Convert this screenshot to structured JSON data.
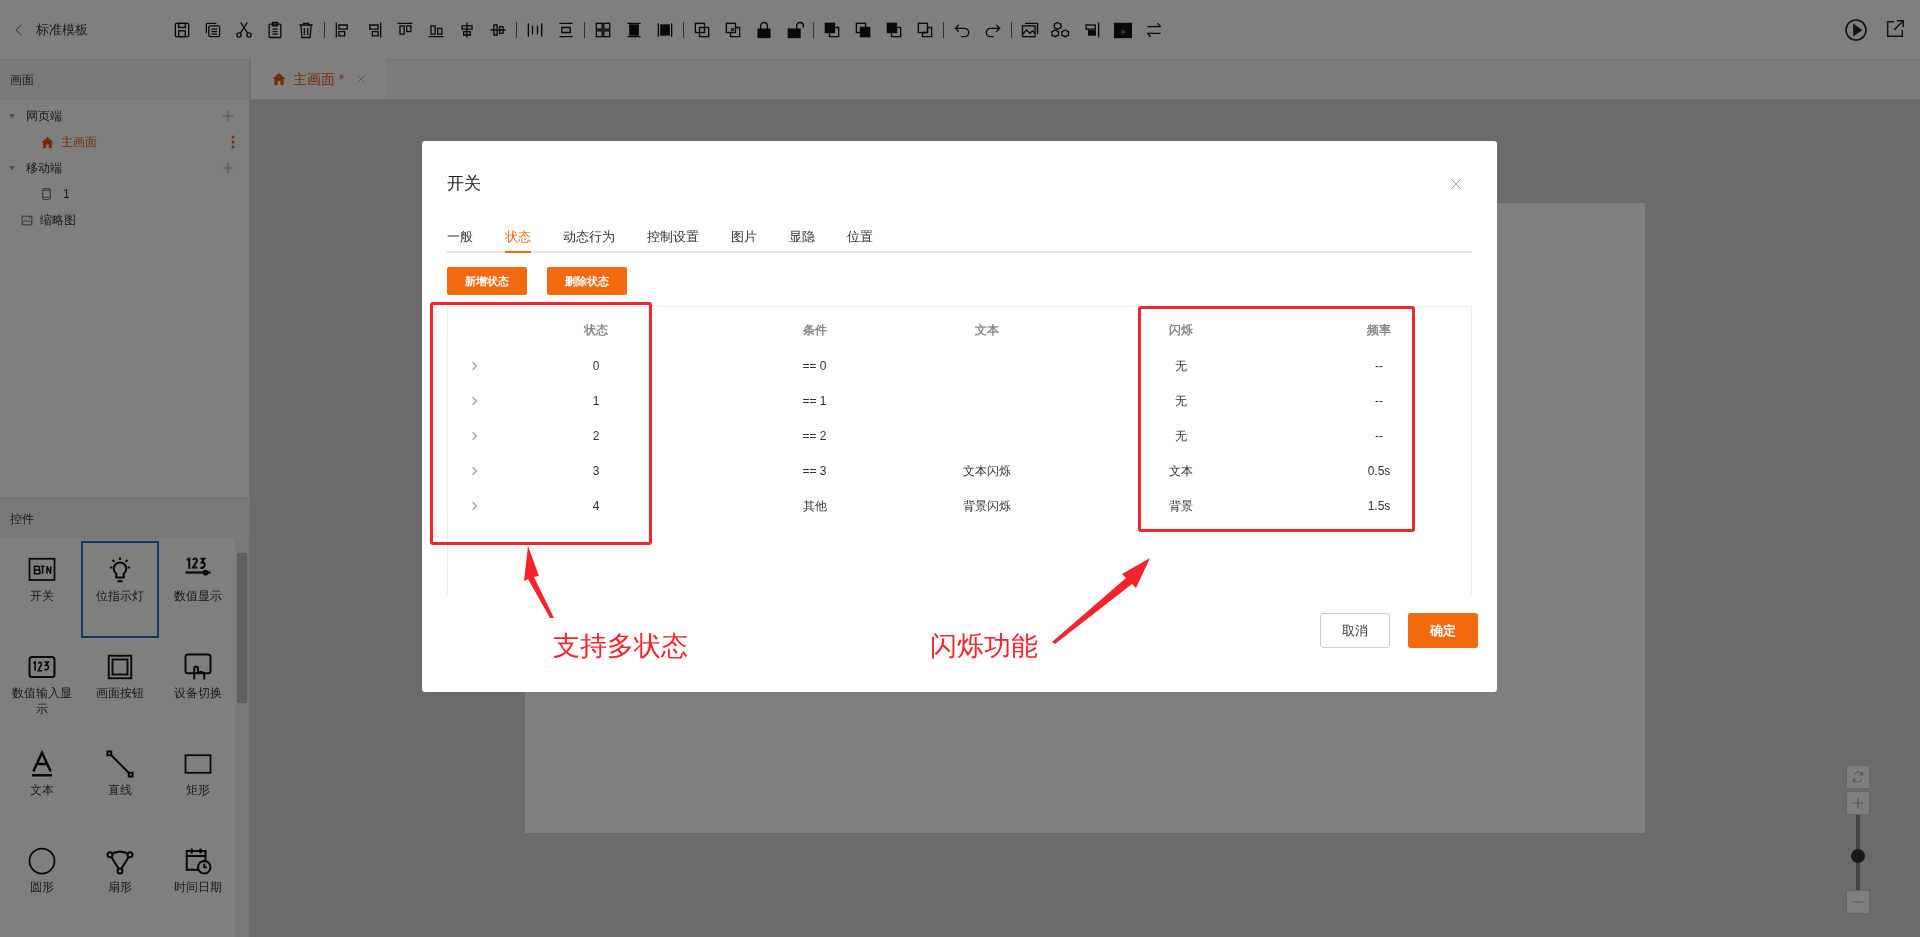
{
  "header": {
    "back_label": "标准模板"
  },
  "sidebar": {
    "screens_title": "画面",
    "tree": [
      {
        "label": "网页端",
        "kind": "group",
        "expanded": true,
        "children": [
          {
            "label": "主画面",
            "kind": "home",
            "selected": true
          }
        ]
      },
      {
        "label": "移动端",
        "kind": "group",
        "expanded": true,
        "children": [
          {
            "label": "1",
            "kind": "mobile",
            "selected": false
          }
        ]
      },
      {
        "label": "缩略图",
        "kind": "thumbnail"
      }
    ],
    "controls_title": "控件",
    "controls": [
      {
        "label": "开关",
        "kind": "btn",
        "selected": false
      },
      {
        "label": "位指示灯",
        "kind": "bulb",
        "selected": true
      },
      {
        "label": "数值显示",
        "kind": "number",
        "selected": false
      },
      {
        "label": "数值输入显示",
        "kind": "number-input",
        "selected": false
      },
      {
        "label": "画面按钮",
        "kind": "frame",
        "selected": false
      },
      {
        "label": "设备切换",
        "kind": "hand",
        "selected": false
      },
      {
        "label": "文本",
        "kind": "text",
        "selected": false
      },
      {
        "label": "直线",
        "kind": "line",
        "selected": false
      },
      {
        "label": "矩形",
        "kind": "rect",
        "selected": false
      },
      {
        "label": "圆形",
        "kind": "circle",
        "selected": false
      },
      {
        "label": "扇形",
        "kind": "sector",
        "selected": false
      },
      {
        "label": "时间日期",
        "kind": "calendar",
        "selected": false
      }
    ]
  },
  "editor_tabs": [
    {
      "label": "主画面",
      "modified_mark": "*",
      "selected": true
    }
  ],
  "dialog": {
    "title": "开关",
    "tabs": [
      {
        "label": "一般",
        "selected": false
      },
      {
        "label": "状态",
        "selected": true
      },
      {
        "label": "动态行为",
        "selected": false
      },
      {
        "label": "控制设置",
        "selected": false
      },
      {
        "label": "图片",
        "selected": false
      },
      {
        "label": "显隐",
        "selected": false
      },
      {
        "label": "位置",
        "selected": false
      }
    ],
    "actions": [
      "新增状态",
      "删除状态"
    ],
    "table": {
      "columns": [
        "状态",
        "条件",
        "文本",
        "闪烁",
        "频率"
      ],
      "rows": [
        {
          "state": "0",
          "condition": "== 0",
          "blink": "无",
          "frequency": "--"
        },
        {
          "state": "1",
          "condition": "== 1",
          "blink": "无",
          "frequency": "--"
        },
        {
          "state": "2",
          "condition": "== 2",
          "blink": "无",
          "frequency": "--"
        },
        {
          "state": "3",
          "condition": "== 3",
          "text": "文本闪烁",
          "blink": "文本",
          "frequency": "0.5s"
        },
        {
          "state": "4",
          "condition": "其他",
          "text": "背景闪烁",
          "blink": "背景",
          "frequency": "1.5s"
        }
      ]
    },
    "cancel": "取消",
    "confirm": "确定"
  },
  "zoom": {
    "level": 0.45
  },
  "annotations": [
    "支持多状态",
    "闪烁功能"
  ]
}
